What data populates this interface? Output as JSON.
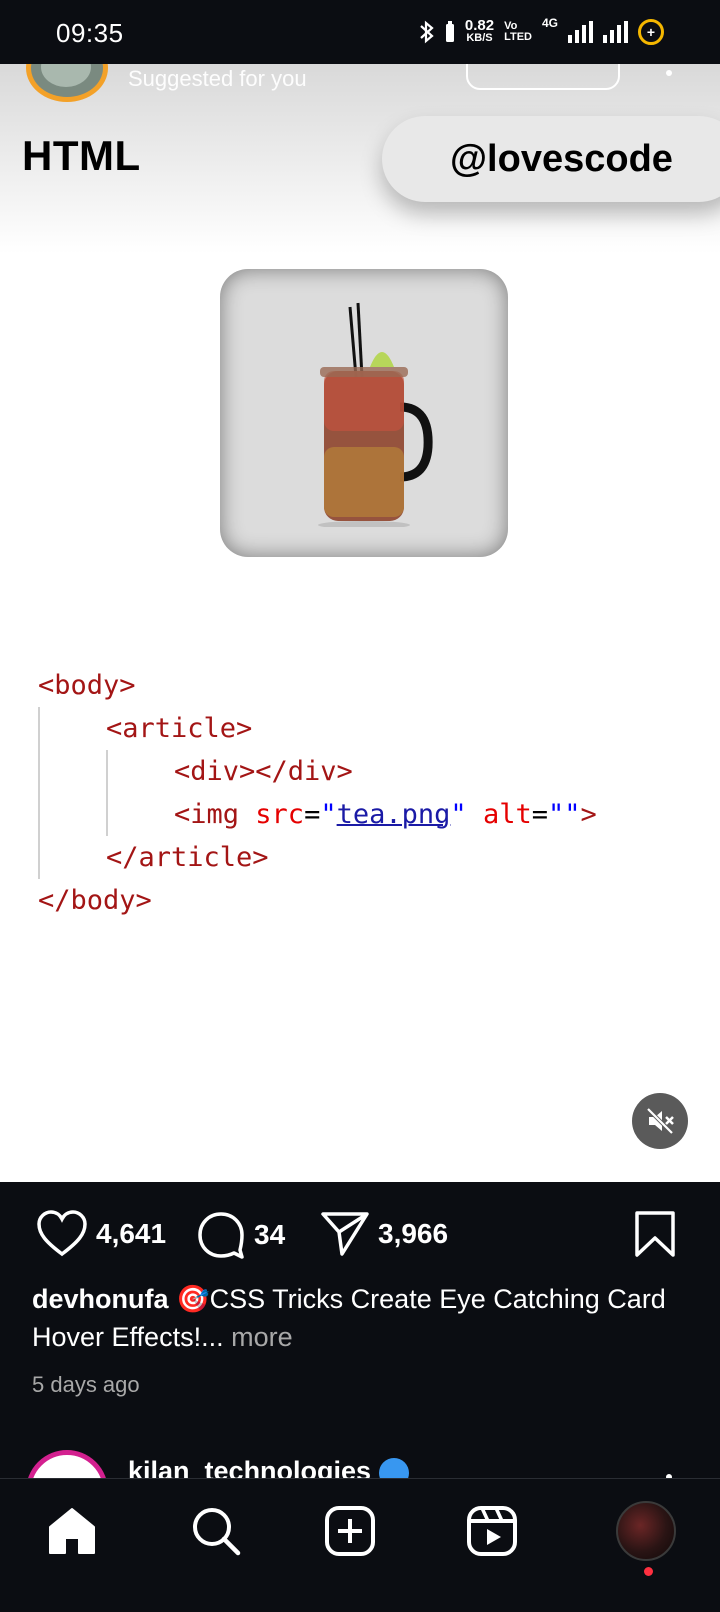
{
  "status_bar": {
    "time": "09:35",
    "net_speed_value": "0.82",
    "net_speed_unit": "KB/S",
    "volte_top": "Vo",
    "volte_bottom": "LTED",
    "network_type": "4G",
    "battery_symbol": "+"
  },
  "post": {
    "suggested_label": "Suggested for you",
    "media": {
      "title": "HTML",
      "handle": "@lovescode",
      "code": {
        "l1_tag": "<body>",
        "l2_tag": "<article>",
        "l3_tag": "<div></div>",
        "l4_open": "<img",
        "l4_attr_src": "src",
        "l4_eq1": "=",
        "l4_q1": "\"",
        "l4_link": "tea.png",
        "l4_q2": "\"",
        "l4_attr_alt": "alt",
        "l4_eq2": "=",
        "l4_empty": "\"\"",
        "l4_close": ">",
        "l5_tag": "</article>",
        "l6_tag": "</body>"
      }
    },
    "actions": {
      "likes": "4,641",
      "comments": "34",
      "shares": "3,966"
    },
    "caption": {
      "username": "devhonufa",
      "emoji": "🎯",
      "text": "CSS Tricks Create Eye Catching Card Hover Effects!...",
      "more": "more"
    },
    "timestamp": "5 days ago"
  },
  "next_post": {
    "username": "kilan_technologies"
  },
  "colors": {
    "background_dark": "#0b0d12",
    "story_ring_orange": "#f3a128",
    "story_ring_pink": "#d3208f",
    "verified_blue": "#3897f0",
    "notification_red": "#ff3040",
    "code_tag": "#a31515",
    "code_attr": "#e50000",
    "code_string": "#0000ff"
  },
  "icons": {
    "nav": [
      "home-icon",
      "search-icon",
      "create-icon",
      "reels-icon",
      "profile-avatar"
    ],
    "actions": [
      "heart-icon",
      "comment-icon",
      "share-icon",
      "bookmark-icon"
    ],
    "media": [
      "mute-icon"
    ]
  }
}
